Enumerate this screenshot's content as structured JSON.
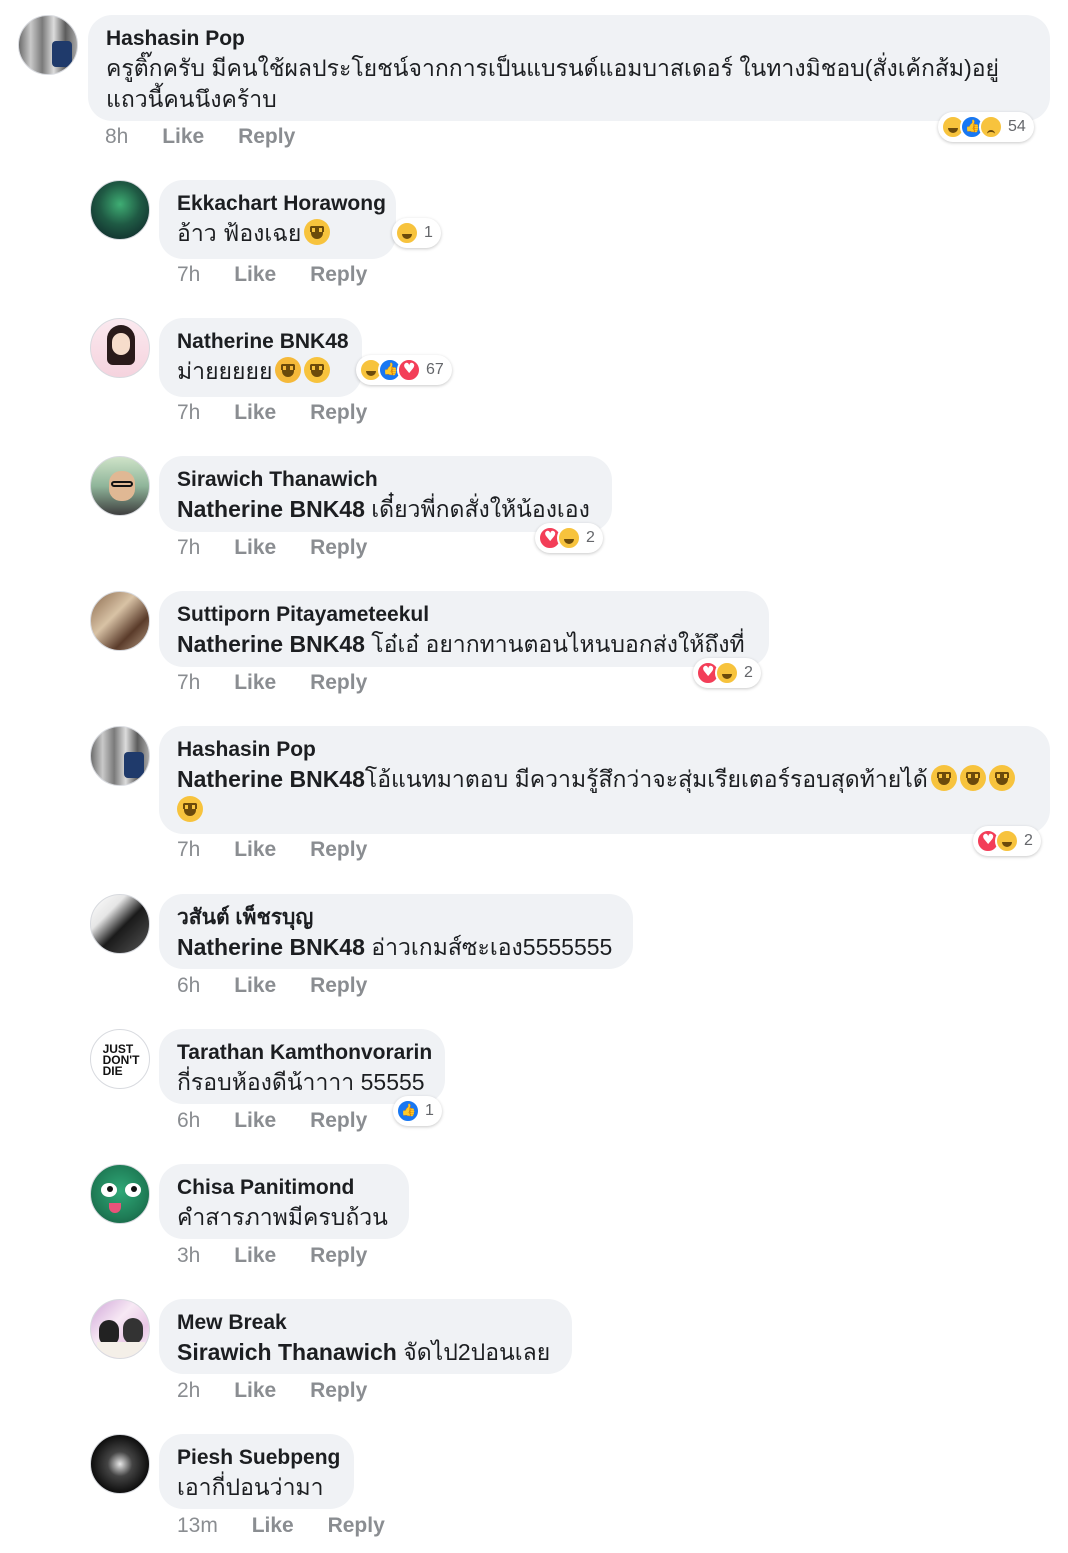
{
  "comments": [
    {
      "author": "Hashasin Pop",
      "text": "ครูติ๊กครับ มีคนใช้ผลประโยชน์จากการเป็นแบรนด์แอมบาสเดอร์ ในทางมิชอบ(สั่งเค้กส้ม)อยู่แถวนี้คนนึงคร้าบ",
      "time": "8h",
      "like": "Like",
      "reply": "Reply",
      "reactions": [
        "haha",
        "like",
        "sad"
      ],
      "reaction_count": "54",
      "avatar_icon": "avatar-jersey-48"
    },
    {
      "author": "Ekkachart Horawong",
      "text": "อ้าว ฟ้องเฉย",
      "time": "7h",
      "like": "Like",
      "reply": "Reply",
      "reactions": [
        "haha"
      ],
      "reaction_count": "1",
      "avatar_icon": "avatar-aurora"
    },
    {
      "author": "Natherine BNK48",
      "text": "ม่ายยยยย",
      "time": "7h",
      "like": "Like",
      "reply": "Reply",
      "reactions": [
        "haha",
        "like",
        "love"
      ],
      "reaction_count": "67",
      "avatar_icon": "avatar-girl"
    },
    {
      "author": "Sirawich Thanawich",
      "mention": "Natherine BNK48",
      "text": " เดี๋ยวพี่กดสั่งให้น้องเอง",
      "time": "7h",
      "like": "Like",
      "reply": "Reply",
      "reactions": [
        "love",
        "haha"
      ],
      "reaction_count": "2",
      "avatar_icon": "avatar-glasses-man"
    },
    {
      "author": "Suttiporn Pitayameteekul",
      "mention": "Natherine BNK48",
      "text": " โอ๋เอ๋ อยากทานตอนไหนบอกส่งให้ถึงที่",
      "time": "7h",
      "like": "Like",
      "reply": "Reply",
      "reactions": [
        "love",
        "haha"
      ],
      "reaction_count": "2",
      "avatar_icon": "avatar-sculpture"
    },
    {
      "author": "Hashasin Pop",
      "mention": "Natherine BNK48",
      "text": "โอ้แนทมาตอบ มีความรู้สึกว่าจะสุ่มเรียเตอร์รอบสุดท้ายได้",
      "time": "7h",
      "like": "Like",
      "reply": "Reply",
      "reactions": [
        "love",
        "haha"
      ],
      "reaction_count": "2",
      "avatar_icon": "avatar-jersey-48"
    },
    {
      "author": "วสันต์ เพ็ชรบุญ",
      "mention": "Natherine BNK48",
      "text": " อ่าวเกมส์ซะเอง5555555",
      "time": "6h",
      "like": "Like",
      "reply": "Reply",
      "avatar_icon": "avatar-bw-man"
    },
    {
      "author": "Tarathan Kamthonvorarin",
      "text": "กี่รอบห้องดีน้าาาา 55555",
      "time": "6h",
      "like": "Like",
      "reply": "Reply",
      "reactions": [
        "like"
      ],
      "reaction_count": "1",
      "avatar_icon": "avatar-just-dont-die",
      "avatar_text": "JUST DON'T DIE"
    },
    {
      "author": "Chisa Panitimond",
      "text": "คำสารภาพมีครบถ้วน",
      "time": "3h",
      "like": "Like",
      "reply": "Reply",
      "avatar_icon": "avatar-green-face"
    },
    {
      "author": "Mew Break",
      "mention": "Sirawich Thanawich",
      "text": " จัดไป2ปอนเลย",
      "time": "2h",
      "like": "Like",
      "reply": "Reply",
      "avatar_icon": "avatar-purple-photo"
    },
    {
      "author": "Piesh Suebpeng",
      "text": "เอากี่ปอนว่ามา",
      "time": "13m",
      "like": "Like",
      "reply": "Reply",
      "avatar_icon": "avatar-dark-hands"
    }
  ],
  "colors": {
    "bubble": "#f0f2f5",
    "meta_text": "#8a8d91",
    "like_blue": "#1877f2",
    "love_red": "#f33e58",
    "haha_yellow": "#f7c33d"
  }
}
